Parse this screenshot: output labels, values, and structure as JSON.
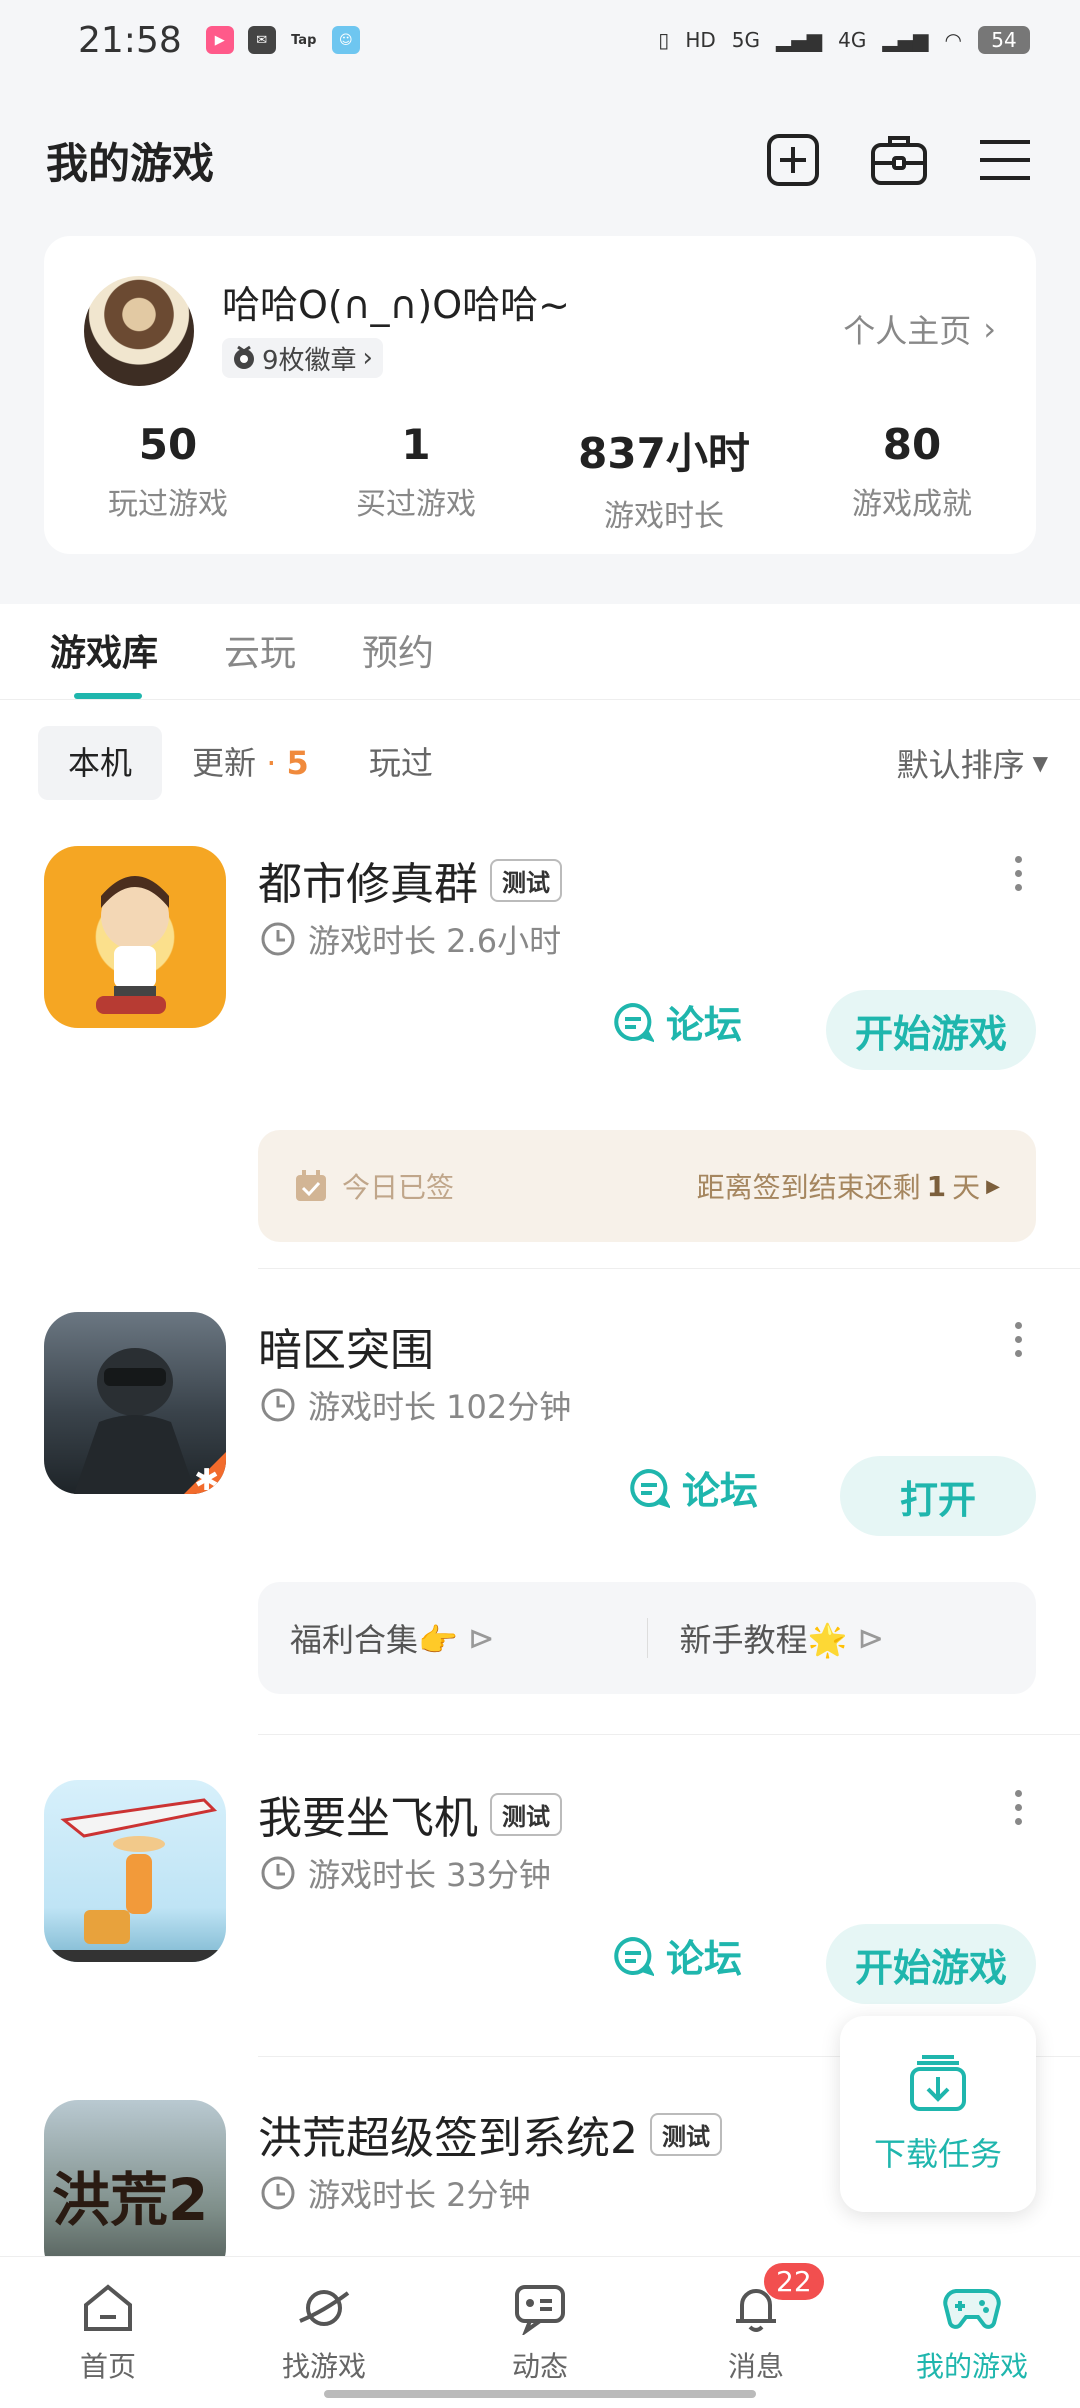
{
  "status_bar": {
    "time": "21:58",
    "tap_label": "Tap",
    "network_hd": "HD",
    "network_5g": "5G",
    "network_4g": "4G",
    "battery": "54"
  },
  "header": {
    "title": "我的游戏"
  },
  "profile": {
    "username": "哈哈O(∩_∩)O哈哈~",
    "badges": "9枚徽章",
    "homepage_label": "个人主页",
    "stats": [
      {
        "value": "50",
        "label": "玩过游戏"
      },
      {
        "value": "1",
        "label": "买过游戏"
      },
      {
        "value": "837小时",
        "label": "游戏时长"
      },
      {
        "value": "80",
        "label": "游戏成就"
      }
    ]
  },
  "tabs": [
    "游戏库",
    "云玩",
    "预约"
  ],
  "filters": {
    "local": "本机",
    "update": "更新",
    "update_dot": "·",
    "update_count": "5",
    "played": "玩过",
    "sort": "默认排序"
  },
  "games": [
    {
      "name": "都市修真群",
      "tag": "测试",
      "time": "游戏时长 2.6小时",
      "forum": "论坛",
      "cta": "开始游戏"
    },
    {
      "name": "暗区突围",
      "time": "游戏时长 102分钟",
      "forum": "论坛",
      "cta": "打开"
    },
    {
      "name": "我要坐飞机",
      "tag": "测试",
      "time": "游戏时长 33分钟",
      "forum": "论坛",
      "cta": "开始游戏"
    },
    {
      "name": "洪荒超级签到系统2",
      "tag": "测试",
      "time": "游戏时长 2分钟"
    }
  ],
  "sign_card": {
    "left": "今日已签",
    "right_prefix": "距离签到结束还剩",
    "right_count": "1",
    "right_suffix": "天"
  },
  "link_card": {
    "left": "福利合集👉",
    "right": "新手教程🌟"
  },
  "game_icon_text": "洪荒2",
  "download_task": "下载任务",
  "bottom_nav": [
    {
      "label": "首页"
    },
    {
      "label": "找游戏"
    },
    {
      "label": "动态"
    },
    {
      "label": "消息",
      "badge": "22"
    },
    {
      "label": "我的游戏"
    }
  ],
  "colors": {
    "accent": "#1fb6ad",
    "orange": "#f08a3c",
    "badge_red": "#f24f4f"
  }
}
